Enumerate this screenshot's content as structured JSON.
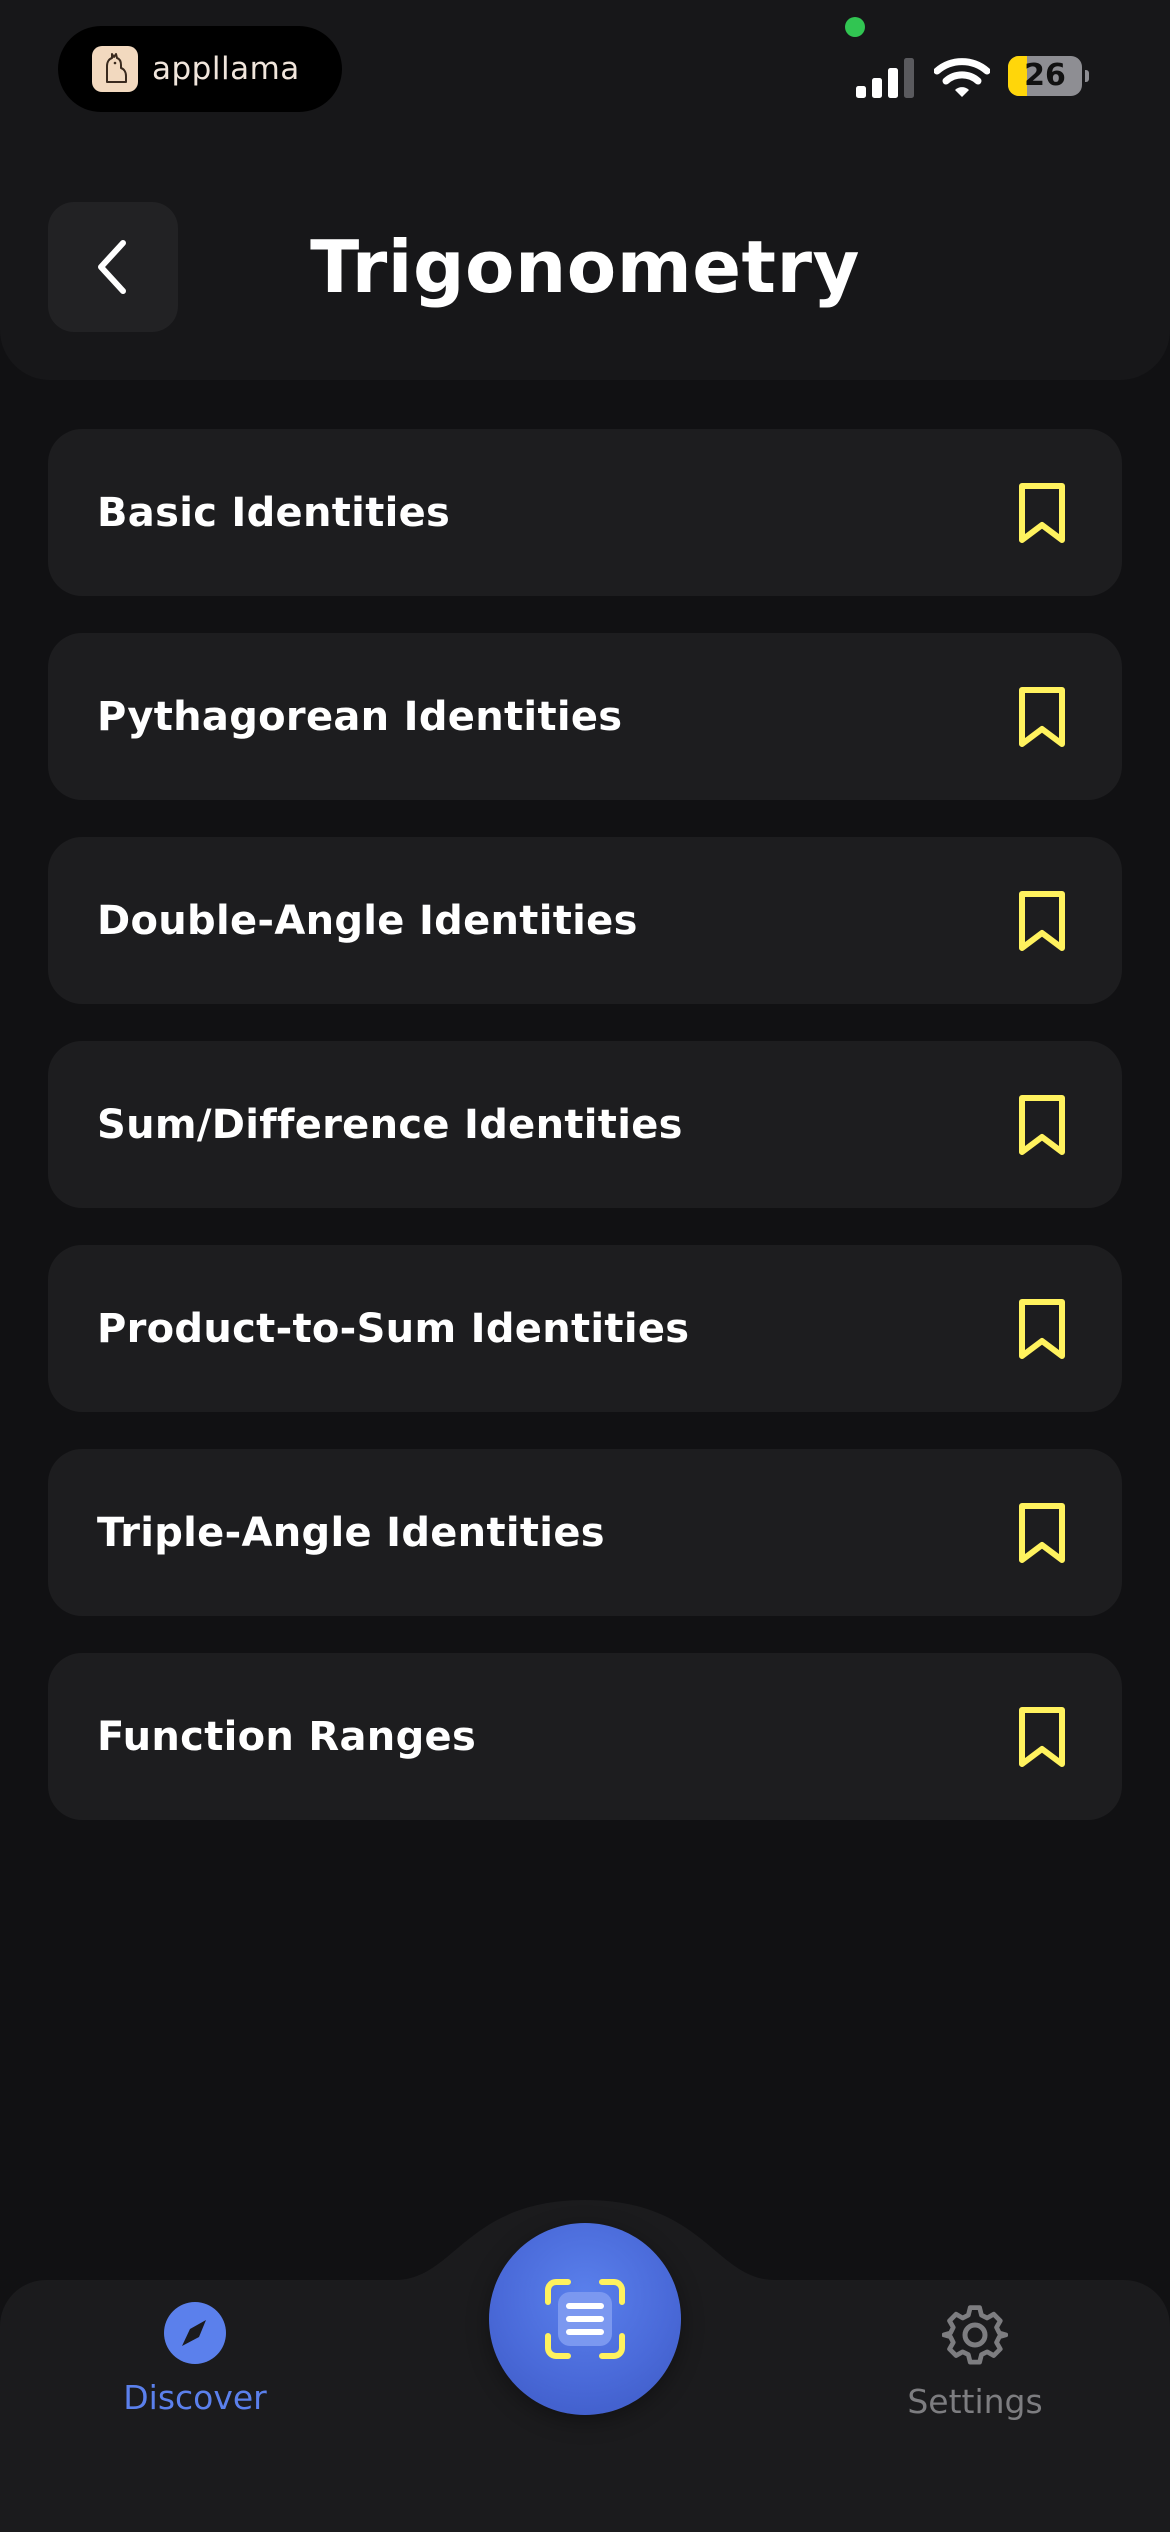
{
  "status_bar": {
    "app_name": "appllama",
    "battery_level": "26",
    "battery_fraction": 0.26,
    "camera_indicator_color": "#31c552"
  },
  "header": {
    "title": "Trigonometry",
    "back_icon": "chevron-left-icon"
  },
  "topics": [
    {
      "label": "Basic Identities",
      "icon": "bookmark-icon"
    },
    {
      "label": "Pythagorean Identities",
      "icon": "bookmark-icon"
    },
    {
      "label": "Double-Angle Identities",
      "icon": "bookmark-icon"
    },
    {
      "label": "Sum/Difference Identities",
      "icon": "bookmark-icon"
    },
    {
      "label": "Product-to-Sum Identities",
      "icon": "bookmark-icon"
    },
    {
      "label": "Triple-Angle Identities",
      "icon": "bookmark-icon"
    },
    {
      "label": "Function Ranges",
      "icon": "bookmark-icon"
    }
  ],
  "tab_bar": {
    "discover": {
      "label": "Discover",
      "icon": "compass-icon",
      "active": true
    },
    "center": {
      "icon": "scan-document-icon"
    },
    "settings": {
      "label": "Settings",
      "icon": "gear-icon",
      "active": false
    }
  },
  "colors": {
    "background": "#111113",
    "card": "#1d1d1f",
    "accent_blue": "#5b80ec",
    "bookmark_yellow": "#fff25e",
    "inactive_gray": "#7d7d80"
  }
}
